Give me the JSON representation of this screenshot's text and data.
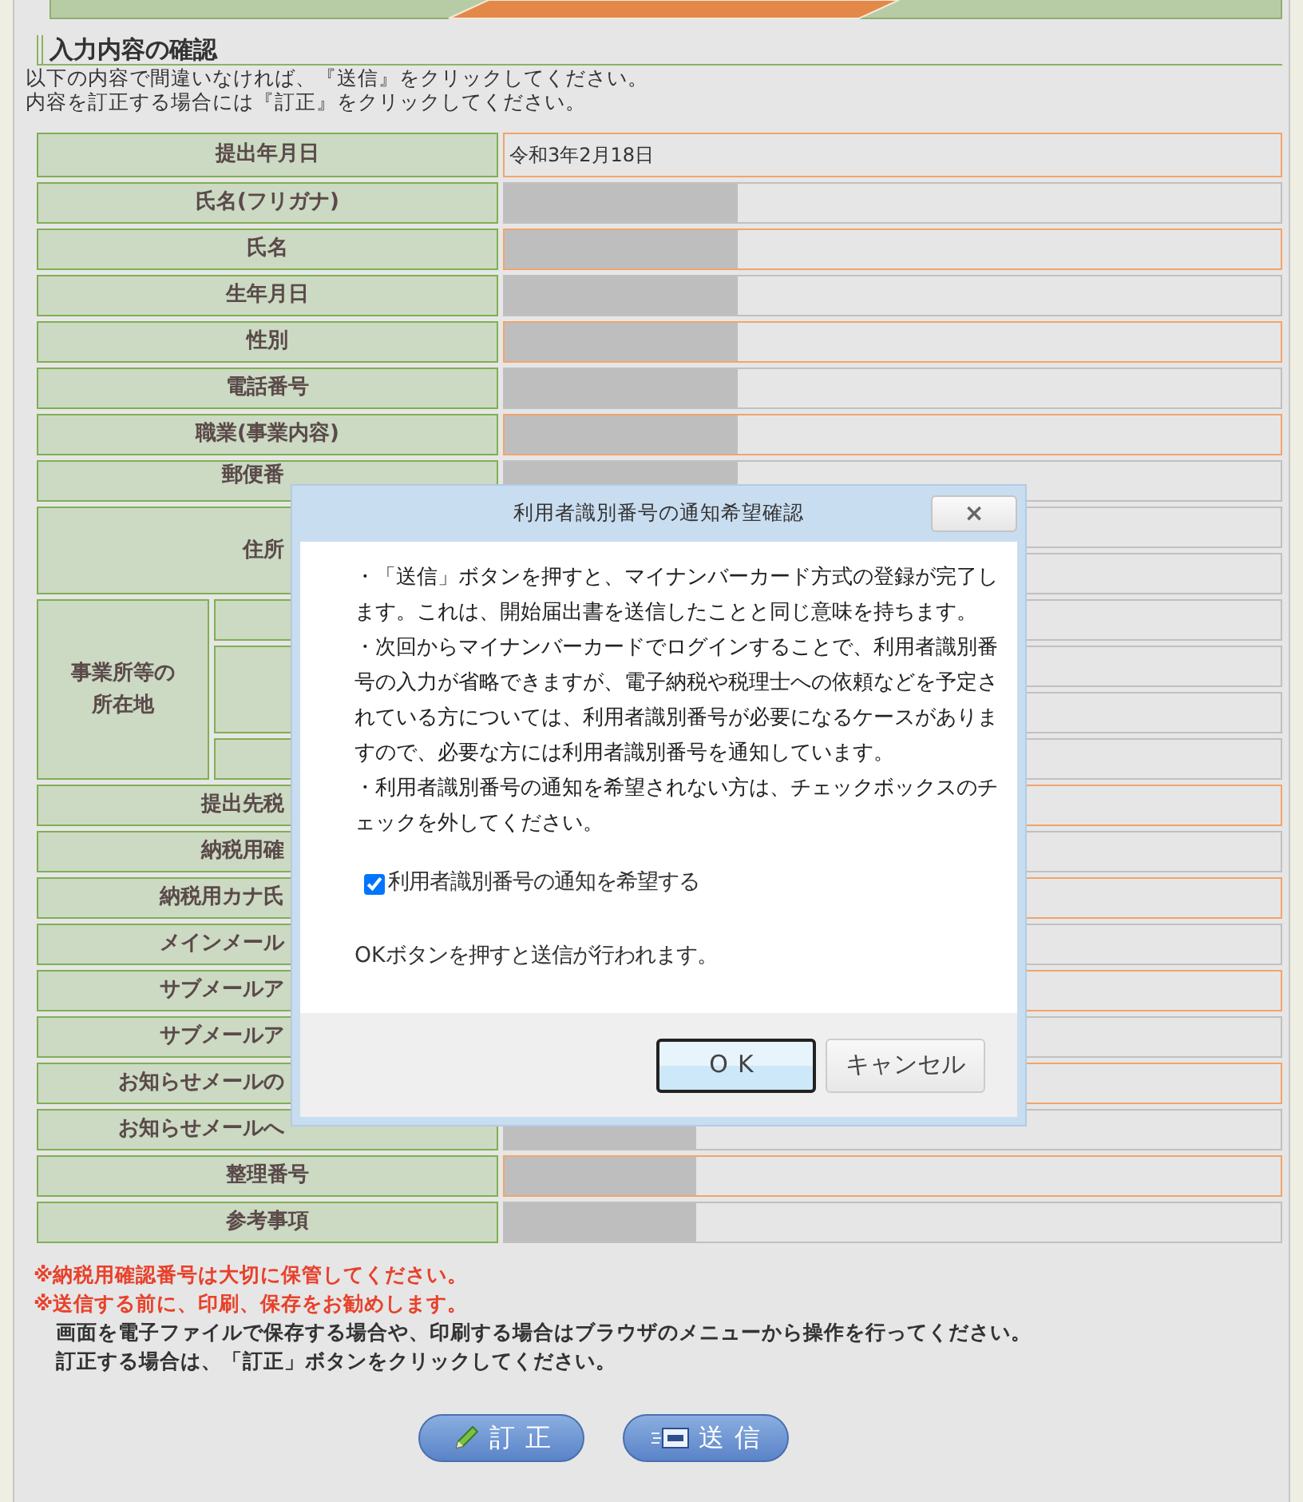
{
  "section": {
    "title": "入力内容の確認",
    "intro": [
      "以下の内容で間違いなければ、『送信』をクリックしてください。",
      "内容を訂正する場合には『訂正』をクリックしてください。"
    ]
  },
  "table": {
    "rows": [
      {
        "kind": "field",
        "label": "提出年月日",
        "value": "令和3年2月18日",
        "redacted": false
      },
      {
        "kind": "field",
        "label": "氏名(フリガナ)",
        "redacted": true
      },
      {
        "kind": "field",
        "label": "氏名",
        "redacted": true
      },
      {
        "kind": "field",
        "label": "生年月日",
        "redacted": true
      },
      {
        "kind": "field",
        "label": "性別",
        "redacted": true
      },
      {
        "kind": "field",
        "label": "電話番号",
        "redacted": true
      },
      {
        "kind": "field",
        "label": "職業(事業内容)",
        "redacted": true
      },
      {
        "kind": "field",
        "label": "郵便番",
        "redacted": true
      },
      {
        "kind": "address",
        "label": "住所",
        "redacted": false
      },
      {
        "kind": "office",
        "label": "事業所等の所在地",
        "redacted": false
      },
      {
        "kind": "field",
        "label": "提出先税",
        "redacted": false
      },
      {
        "kind": "field",
        "label": "納税用確",
        "redacted": false
      },
      {
        "kind": "field",
        "label": "納税用カナ氏",
        "redacted": false
      },
      {
        "kind": "field",
        "label": "メインメール",
        "redacted": false
      },
      {
        "kind": "field",
        "label": "サブメールア",
        "redacted": false
      },
      {
        "kind": "field",
        "label": "サブメールア",
        "redacted": false
      },
      {
        "kind": "field",
        "label": "お知らせメールの",
        "redacted": false
      },
      {
        "kind": "field",
        "label": "お知らせメールへ",
        "redacted": true
      },
      {
        "kind": "field",
        "label": "整理番号",
        "redacted": true
      },
      {
        "kind": "field",
        "label": "参考事項",
        "redacted": true
      }
    ]
  },
  "notes": [
    {
      "kind": "warning",
      "text": "※納税用確認番号は大切に保管してください。"
    },
    {
      "kind": "warning",
      "text": "※送信する前に、印刷、保存をお勧めします。"
    },
    {
      "kind": "info",
      "text": "画面を電子ファイルで保存する場合や、印刷する場合はブラウザのメニューから操作を行ってください。"
    },
    {
      "kind": "info",
      "text": "訂正する場合は、「訂正」ボタンをクリックしてください。"
    }
  ],
  "actions": [
    {
      "kind": "edit",
      "label": "訂正"
    },
    {
      "kind": "send",
      "label": "送信"
    }
  ],
  "dialog": {
    "title": "利用者識別番号の通知希望確認",
    "close": "×",
    "paragraphs": [
      "・「送信」ボタンを押すと、マイナンバーカード方式の登録が完了します。これは、開始届出書を送信したことと同じ意味を持ちます。",
      "・次回からマイナンバーカードでログインすることで、利用者識別番号の入力が省略できますが、電子納税や税理士への依頼などを予定されている方については、利用者識別番号が必要になるケースがありますので、必要な方には利用者識別番号を通知しています。",
      "・利用者識別番号の通知を希望されない方は、チェックボックスのチェックを外してください。"
    ],
    "checkbox": {
      "label": "利用者識別番号の通知を希望する",
      "checked": true
    },
    "footnote": "OKボタンを押すと送信が行われます。",
    "buttons": [
      {
        "label": "OK",
        "focused": true
      },
      {
        "label": "キャンセル",
        "focused": false
      }
    ]
  }
}
